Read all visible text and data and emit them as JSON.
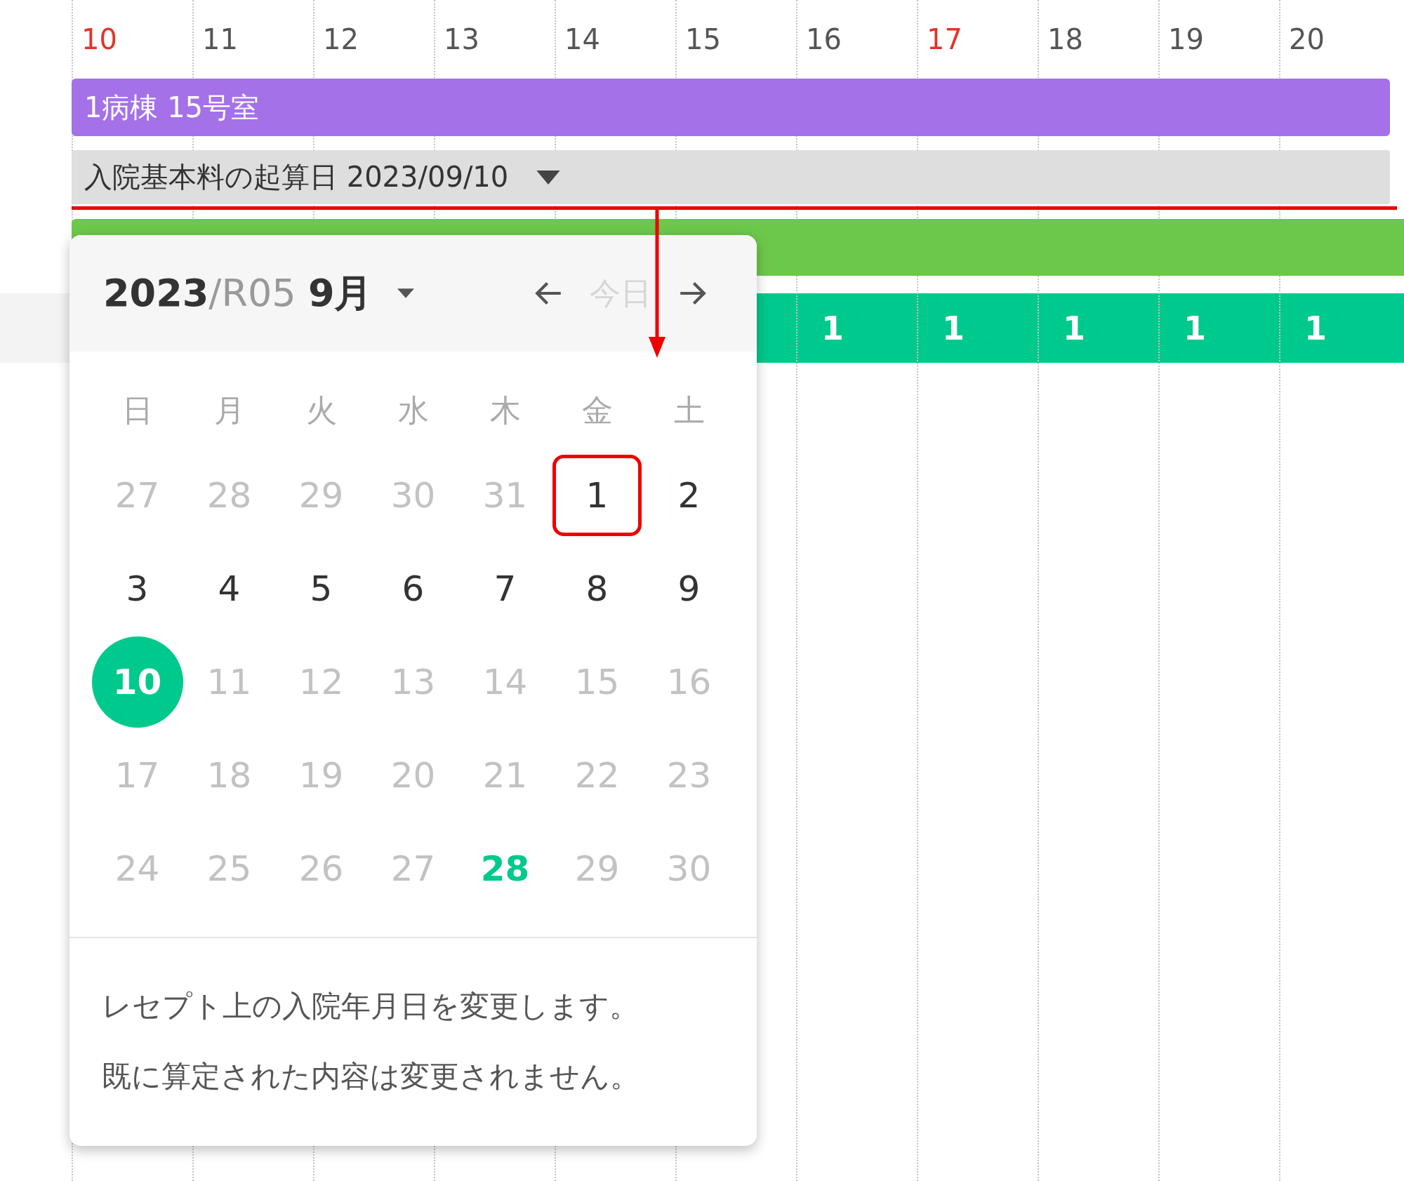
{
  "timeline": {
    "days": [
      {
        "label": "10",
        "sunday": true
      },
      {
        "label": "11",
        "sunday": false
      },
      {
        "label": "12",
        "sunday": false
      },
      {
        "label": "13",
        "sunday": false
      },
      {
        "label": "14",
        "sunday": false
      },
      {
        "label": "15",
        "sunday": false
      },
      {
        "label": "16",
        "sunday": false
      },
      {
        "label": "17",
        "sunday": true
      },
      {
        "label": "18",
        "sunday": false
      },
      {
        "label": "19",
        "sunday": false
      },
      {
        "label": "20",
        "sunday": false
      }
    ],
    "bars": [
      {
        "kind": "ward",
        "label": "1病棟 15号室"
      },
      {
        "kind": "start_date",
        "label": "入院基本料の起算日 2023/09/10"
      },
      {
        "kind": "plain"
      }
    ],
    "counts": [
      "1",
      "1",
      "1",
      "1",
      "1"
    ]
  },
  "date_picker": {
    "title": "**2023**/R05 **9月**",
    "today_button": {
      "label": "今日",
      "disabled": true
    },
    "weekdays": [
      "日",
      "月",
      "火",
      "水",
      "木",
      "金",
      "土"
    ],
    "weeks": [
      [
        {
          "label": "27",
          "kind": "outside",
          "highlighted": false
        },
        {
          "label": "28",
          "kind": "outside",
          "highlighted": false
        },
        {
          "label": "29",
          "kind": "outside",
          "highlighted": false
        },
        {
          "label": "30",
          "kind": "outside",
          "highlighted": false
        },
        {
          "label": "31",
          "kind": "outside",
          "highlighted": false
        },
        {
          "label": "1",
          "kind": "enabled",
          "highlighted": true
        },
        {
          "label": "2",
          "kind": "enabled",
          "highlighted": false
        }
      ],
      [
        {
          "label": "3",
          "kind": "enabled",
          "highlighted": false
        },
        {
          "label": "4",
          "kind": "enabled",
          "highlighted": false
        },
        {
          "label": "5",
          "kind": "enabled",
          "highlighted": false
        },
        {
          "label": "6",
          "kind": "enabled",
          "highlighted": false
        },
        {
          "label": "7",
          "kind": "enabled",
          "highlighted": false
        },
        {
          "label": "8",
          "kind": "enabled",
          "highlighted": false
        },
        {
          "label": "9",
          "kind": "enabled",
          "highlighted": false
        }
      ],
      [
        {
          "label": "10",
          "kind": "selected",
          "highlighted": false
        },
        {
          "label": "11",
          "kind": "disabled",
          "highlighted": false
        },
        {
          "label": "12",
          "kind": "disabled",
          "highlighted": false
        },
        {
          "label": "13",
          "kind": "disabled",
          "highlighted": false
        },
        {
          "label": "14",
          "kind": "disabled",
          "highlighted": false
        },
        {
          "label": "15",
          "kind": "disabled",
          "highlighted": false
        },
        {
          "label": "16",
          "kind": "disabled",
          "highlighted": false
        }
      ],
      [
        {
          "label": "17",
          "kind": "disabled",
          "highlighted": false
        },
        {
          "label": "18",
          "kind": "disabled",
          "highlighted": false
        },
        {
          "label": "19",
          "kind": "disabled",
          "highlighted": false
        },
        {
          "label": "20",
          "kind": "disabled",
          "highlighted": false
        },
        {
          "label": "21",
          "kind": "disabled",
          "highlighted": false
        },
        {
          "label": "22",
          "kind": "disabled",
          "highlighted": false
        },
        {
          "label": "23",
          "kind": "disabled",
          "highlighted": false
        }
      ],
      [
        {
          "label": "24",
          "kind": "disabled",
          "highlighted": false
        },
        {
          "label": "25",
          "kind": "disabled",
          "highlighted": false
        },
        {
          "label": "26",
          "kind": "disabled",
          "highlighted": false
        },
        {
          "label": "27",
          "kind": "disabled",
          "highlighted": false
        },
        {
          "label": "28",
          "kind": "today",
          "highlighted": false
        },
        {
          "label": "29",
          "kind": "disabled",
          "highlighted": false
        },
        {
          "label": "30",
          "kind": "disabled",
          "highlighted": false
        }
      ]
    ],
    "notes": [
      "レセプト上の入院年月日を変更します。",
      "既に算定された内容は変更されません。"
    ]
  }
}
